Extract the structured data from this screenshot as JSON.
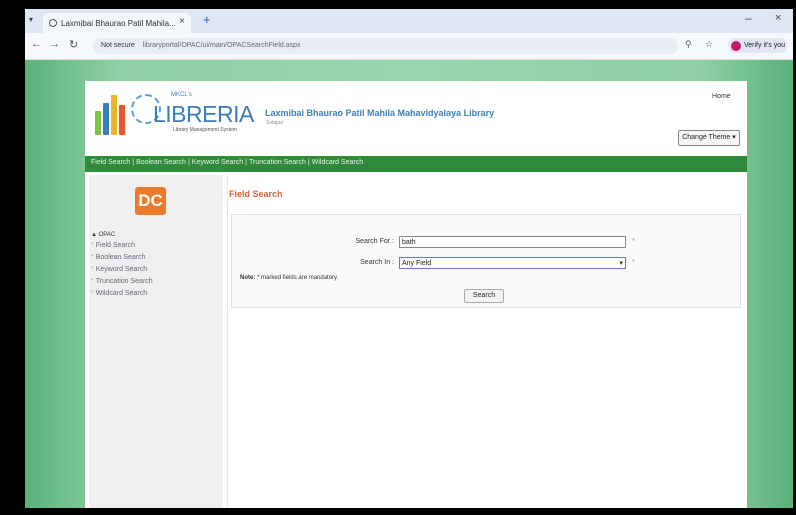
{
  "browser": {
    "tab_title": "Laxmibai Bhaurao Patil Mahila...",
    "tab_close": "×",
    "new_tab": "+",
    "minimize": "–",
    "close": "×",
    "url_prefix": "Not secure",
    "url": "libraryportal/OPAC/ui/main/OPACSearchField.aspx",
    "profile_label": "Verify it's you"
  },
  "header": {
    "logo_small_top": "MKCL's",
    "logo_brand": "LIBRERIA",
    "logo_tagline": "Library Management System",
    "library_title": "Laxmibai Bhaurao Patil Mahila Mahavidyalaya Library",
    "library_subtitle": "Solapur",
    "home_link": "Home",
    "change_theme": "Change Theme ▾"
  },
  "navbar": {
    "items": [
      "Field Search",
      "Boolean Search",
      "Keyword Search",
      "Truncation Search",
      "Wildcard Search"
    ]
  },
  "sidebar": {
    "logo_text": "DC",
    "heading": "▲ OPAC",
    "items": [
      "Field Search",
      "Boolean Search",
      "Keyword Search",
      "Truncation Search",
      "Wildcard Search"
    ]
  },
  "main": {
    "title": "Field Search",
    "search_for_label": "Search For :",
    "search_for_value": "bath",
    "search_in_label": "Search In :",
    "search_in_value": "Any Field",
    "required_mark": "*",
    "note_label": "Note:",
    "note_text": "* marked fields are mandatory.",
    "search_button": "Search"
  },
  "colors": {
    "page_green": "#8fd0a4",
    "nav_green": "#2f8a3c",
    "title_orange": "#d8612a",
    "logo_orange": "#ef7a2c",
    "library_title_blue": "#3f7fb6"
  }
}
